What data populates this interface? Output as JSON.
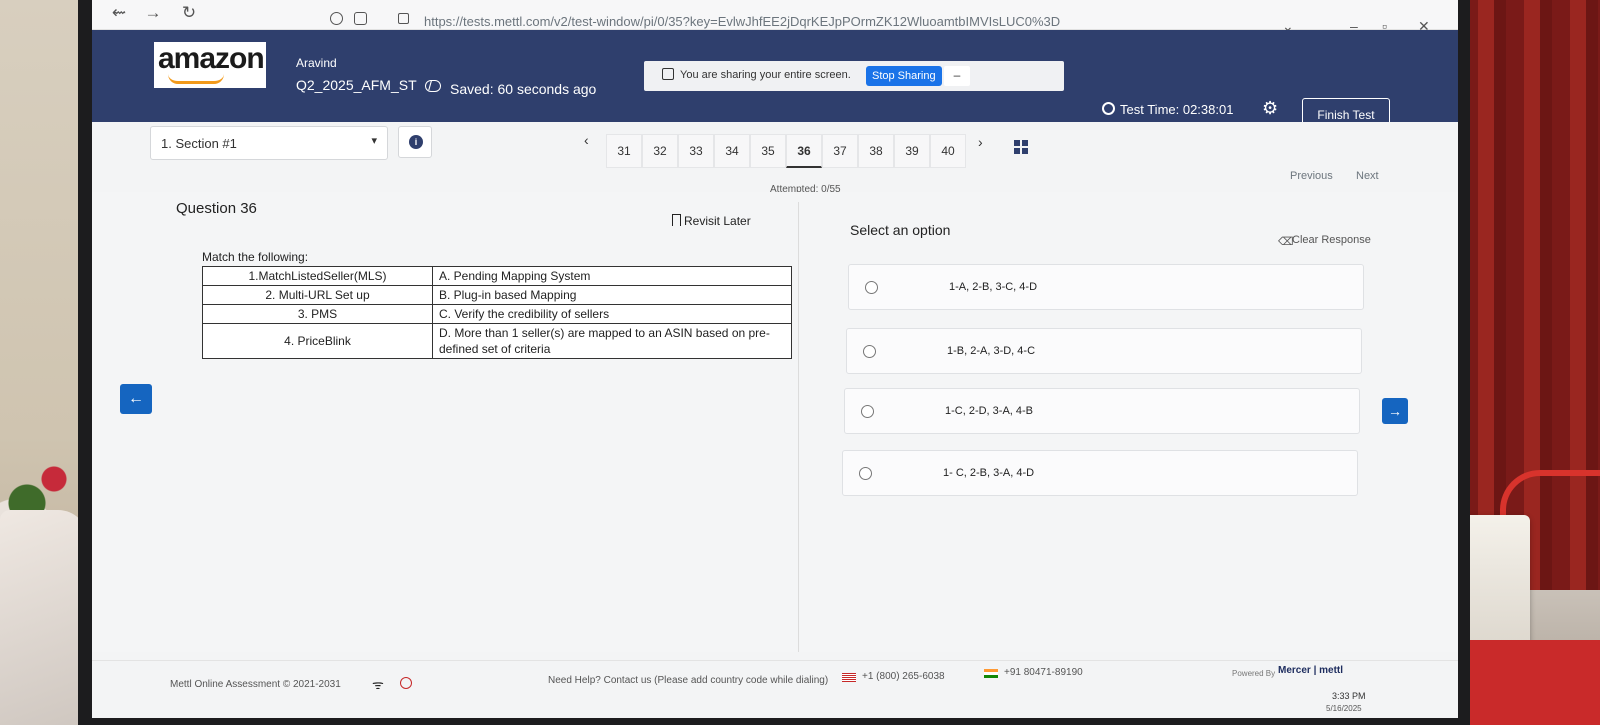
{
  "browser": {
    "url": "https://tests.mettl.com/v2/test-window/pi/0/35?key=EvlwJhfEE2jDqrKEJpPOrmZK12WluoamtbIMVIsLUC0%3D"
  },
  "header": {
    "logo_text": "amazon",
    "user_name": "Aravind",
    "test_name": "Q2_2025_AFM_ST",
    "separator": "/",
    "saved_status": "Saved: 60 seconds ago",
    "test_time": "Test Time: 02:38:01",
    "finish_label": "Finish Test"
  },
  "screen_share": {
    "message": "You are sharing your entire screen.",
    "stop_label": "Stop Sharing",
    "minimize_label": "–"
  },
  "navigation": {
    "section_label": "1. Section #1",
    "question_numbers": [
      "31",
      "32",
      "33",
      "34",
      "35",
      "36",
      "37",
      "38",
      "39",
      "40"
    ],
    "active_question": "36",
    "attempted": "Attempted: 0/55",
    "previous_label": "Previous",
    "next_label": "Next"
  },
  "question": {
    "title": "Question 36",
    "revisit_label": "Revisit Later",
    "stem": "Match the following:",
    "table": [
      [
        "1.MatchListedSeller(MLS)",
        "A. Pending Mapping System"
      ],
      [
        "2. Multi-URL Set up",
        "B. Plug-in based Mapping"
      ],
      [
        "3. PMS",
        "C. Verify the credibility of sellers"
      ],
      [
        "4. PriceBlink",
        "D. More than 1 seller(s) are mapped to an ASIN based on pre-defined set of criteria"
      ]
    ]
  },
  "answer": {
    "select_label": "Select an option",
    "clear_label": "Clear Response",
    "options": [
      "1-A, 2-B, 3-C, 4-D",
      "1-B, 2-A, 3-D, 4-C",
      "1-C, 2-D, 3-A, 4-B",
      "1- C, 2-B, 3-A, 4-D"
    ]
  },
  "footer": {
    "copyright": "Mettl Online Assessment © 2021-2031",
    "help_text": "Need Help? Contact us (Please add country code while dialing)",
    "us_phone": "+1 (800) 265-6038",
    "in_phone": "+91 80471-89190",
    "powered_by": "Powered By",
    "brand": "Mercer | mettl"
  },
  "taskbar": {
    "time": "3:33 PM",
    "date": "5/16/2025"
  },
  "colors": {
    "header_bg": "#2f3f6d",
    "accent_blue": "#1565c0",
    "stop_sharing": "#1a73e8"
  }
}
